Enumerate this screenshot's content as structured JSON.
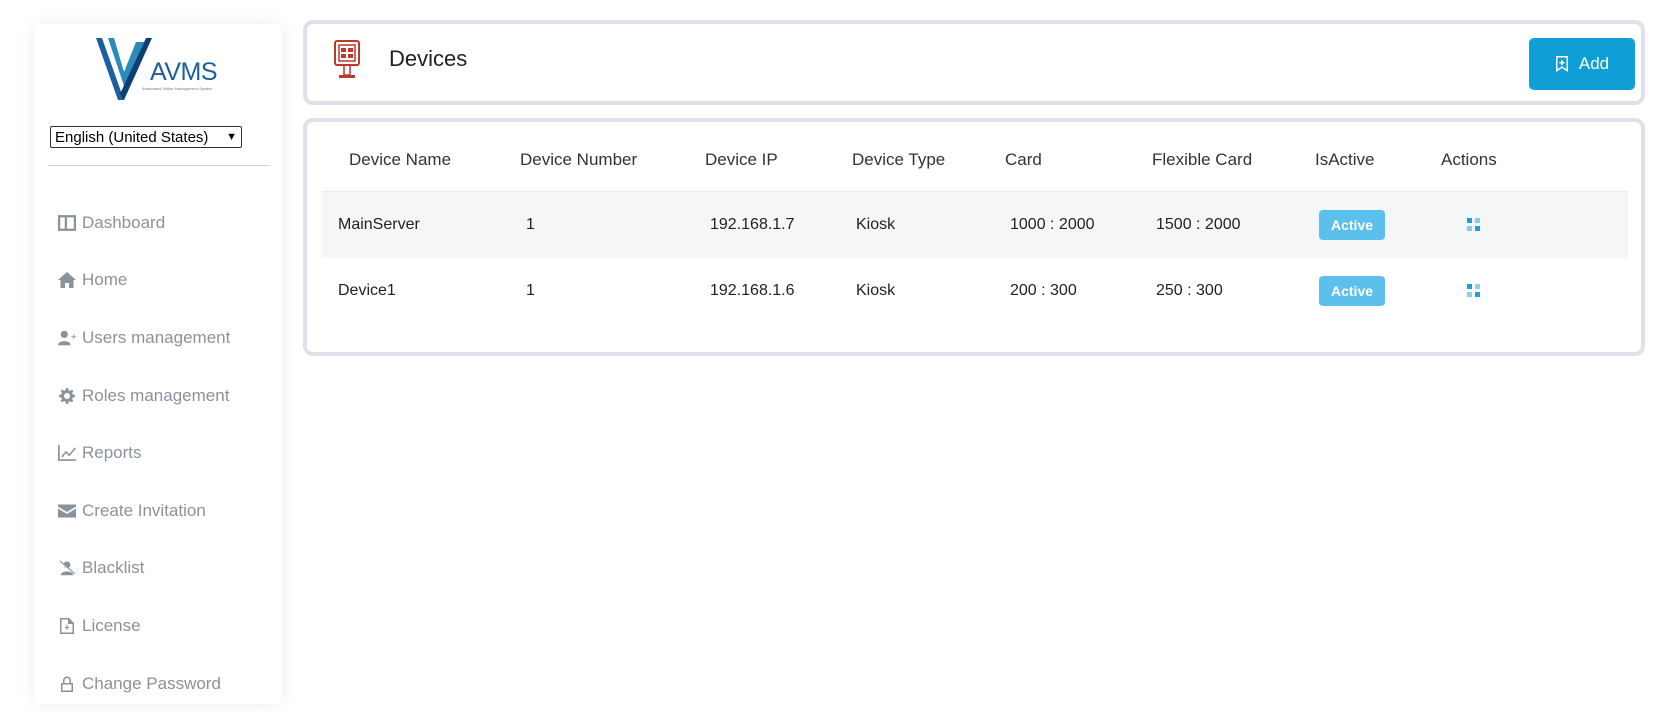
{
  "sidebar": {
    "logo": {
      "text": "AVMS",
      "subtitle": "Automated Visitor Management System"
    },
    "language": "English (United States)",
    "items": [
      {
        "label": "Dashboard",
        "icon": "dashboard-icon"
      },
      {
        "label": "Home",
        "icon": "home-icon"
      },
      {
        "label": "Users management",
        "icon": "user-plus-icon"
      },
      {
        "label": "Roles management",
        "icon": "gear-icon"
      },
      {
        "label": "Reports",
        "icon": "chart-icon"
      },
      {
        "label": "Create Invitation",
        "icon": "envelope-icon"
      },
      {
        "label": "Blacklist",
        "icon": "user-slash-icon"
      },
      {
        "label": "License",
        "icon": "file-icon"
      },
      {
        "label": "Change Password",
        "icon": "lock-icon"
      }
    ]
  },
  "header": {
    "title": "Devices",
    "add_label": "Add"
  },
  "table": {
    "columns": [
      "Device Name",
      "Device Number",
      "Device IP",
      "Device Type",
      "Card",
      "Flexible Card",
      "IsActive",
      "Actions"
    ],
    "rows": [
      {
        "name": "MainServer",
        "number": "1",
        "ip": "192.168.1.7",
        "type": "Kiosk",
        "card": "1000 : 2000",
        "flex": "1500 : 2000",
        "status": "Active"
      },
      {
        "name": "Device1",
        "number": "1",
        "ip": "192.168.1.6",
        "type": "Kiosk",
        "card": "200 : 300",
        "flex": "250 : 300",
        "status": "Active"
      }
    ]
  },
  "colors": {
    "accent": "#0f9ed6",
    "badge": "#5bc0eb",
    "nav_text": "#8a929b",
    "card_border": "#dde1ea"
  }
}
